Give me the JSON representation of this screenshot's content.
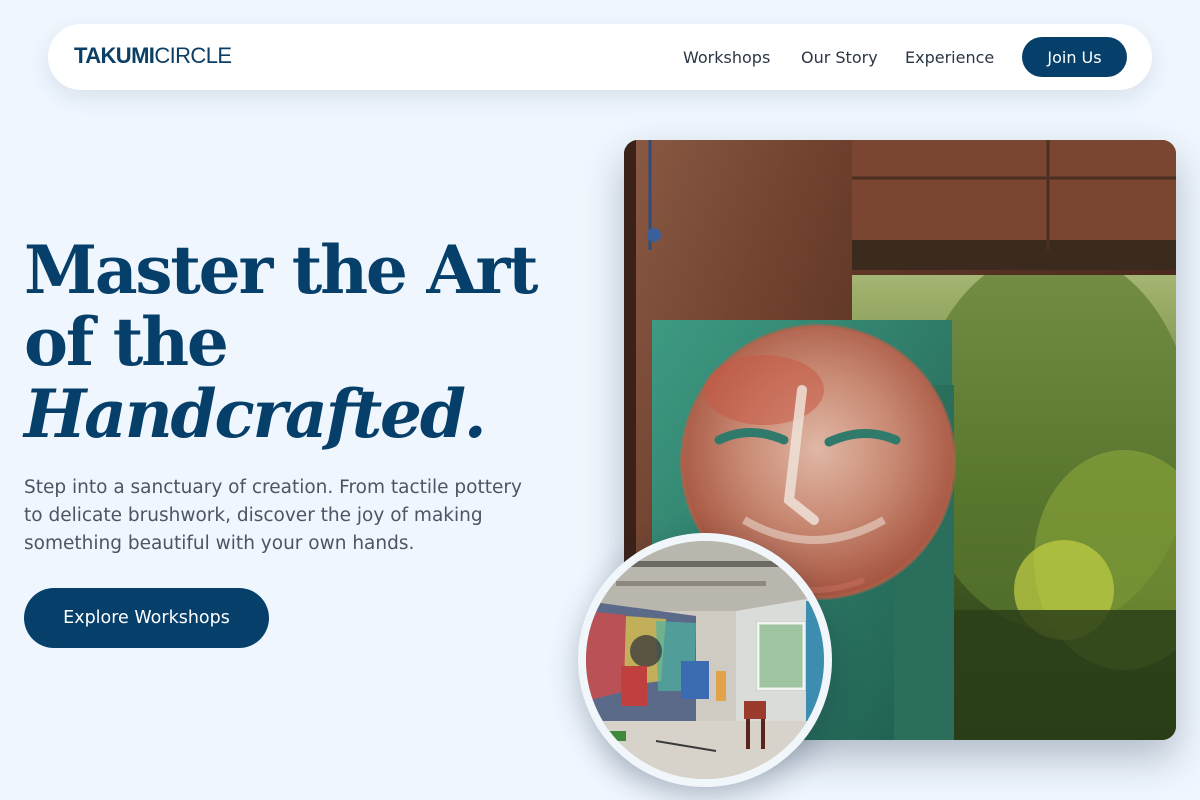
{
  "brand": {
    "name_bold": "TAKUMI",
    "name_light": "CIRCLE"
  },
  "nav": {
    "links": [
      "Workshops",
      "Our Story",
      "Experience"
    ],
    "cta_label": "Join Us"
  },
  "hero": {
    "headline_line1": "Master the Art",
    "headline_line2": "of the",
    "headline_line3": "Handcrafted.",
    "description": "Step into a sanctuary of creation. From tactile pottery to delicate brushwork, discover the joy of making something beautiful with your own hands.",
    "cta_label": "Explore Workshops"
  },
  "images": {
    "main": "mural-face-painting-photo",
    "inset": "graffiti-art-studio-photo"
  },
  "colors": {
    "page_background": "#eff6fd",
    "brand_navy": "#053f6a",
    "body_text": "#4b5563",
    "nav_text": "#2a3644",
    "nav_background": "#ffffff"
  }
}
